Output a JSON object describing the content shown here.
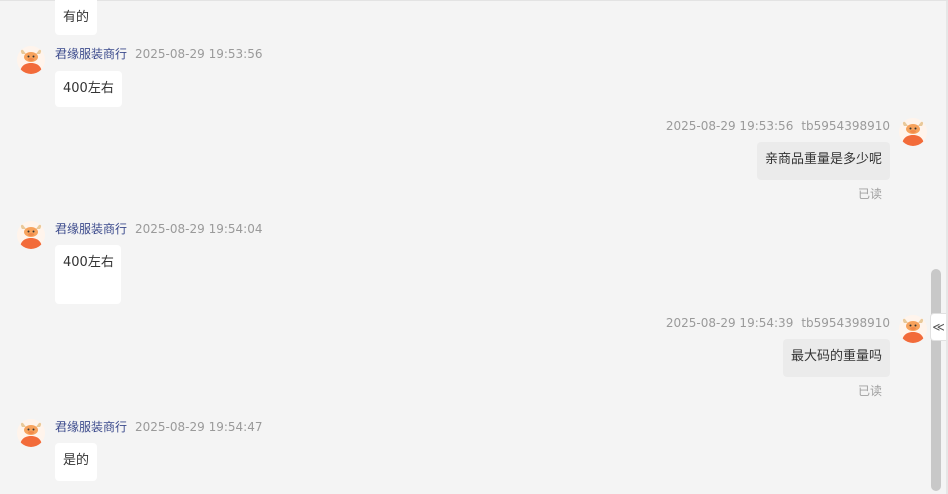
{
  "messages": [
    {
      "text": "有的"
    },
    {
      "sender": "君缘服装商行",
      "time": "2025-08-29 19:53:56",
      "text": "400左右"
    },
    {
      "sender": "tb5954398910",
      "time": "2025-08-29 19:53:56",
      "text": "亲商品重量是多少呢",
      "status": "已读"
    },
    {
      "sender": "君缘服装商行",
      "time": "2025-08-29 19:54:04",
      "text": "400左右"
    },
    {
      "sender": "tb5954398910",
      "time": "2025-08-29 19:54:39",
      "text": "最大码的重量吗",
      "status": "已读"
    },
    {
      "sender": "君缘服装商行",
      "time": "2025-08-29 19:54:47",
      "text": "是的"
    }
  ],
  "ui": {
    "collapse_glyph": "≪",
    "avatar_icon": "cartoon-ox-avatar",
    "colors": {
      "background": "#f4f4f4",
      "seller_name": "#3b4a8c",
      "meta_gray": "#9a9a9a",
      "incoming_bubble": "#ffffff",
      "outgoing_bubble": "#ebebeb",
      "avatar_orange": "#f26b3a"
    }
  }
}
